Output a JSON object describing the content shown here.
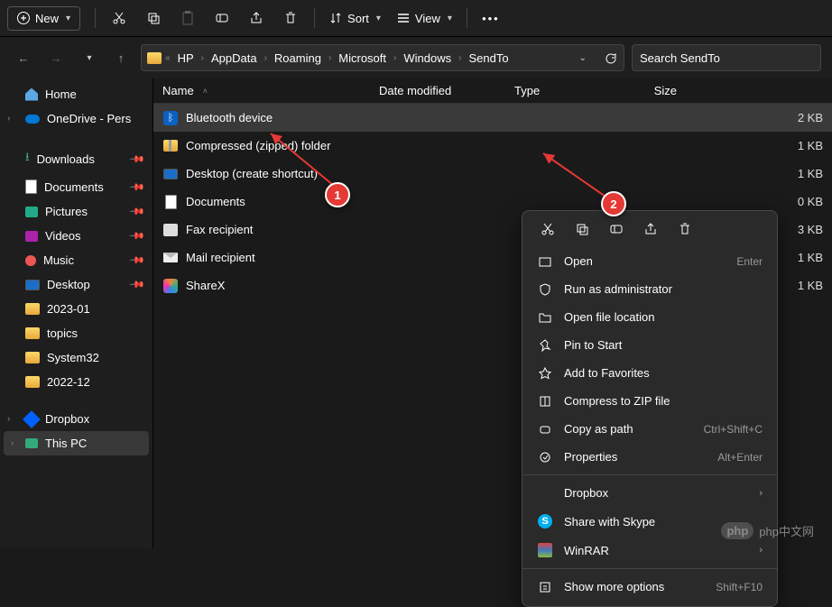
{
  "toolbar": {
    "new_label": "New",
    "sort_label": "Sort",
    "view_label": "View"
  },
  "breadcrumb": [
    "HP",
    "AppData",
    "Roaming",
    "Microsoft",
    "Windows",
    "SendTo"
  ],
  "search_placeholder": "Search SendTo",
  "columns": {
    "name": "Name",
    "date": "Date modified",
    "type": "Type",
    "size": "Size"
  },
  "sidebar": {
    "home": "Home",
    "onedrive": "OneDrive - Pers",
    "quick": [
      "Downloads",
      "Documents",
      "Pictures",
      "Videos",
      "Music",
      "Desktop",
      "2023-01",
      "topics",
      "System32",
      "2022-12"
    ],
    "bottom": [
      "Dropbox",
      "This PC"
    ]
  },
  "files": [
    {
      "name": "Bluetooth device",
      "size": "2 KB",
      "icon": "bluetooth"
    },
    {
      "name": "Compressed (zipped) folder",
      "size": "1 KB",
      "icon": "zip"
    },
    {
      "name": "Desktop (create shortcut)",
      "size": "1 KB",
      "icon": "monitor"
    },
    {
      "name": "Documents",
      "size": "0 KB",
      "icon": "doc"
    },
    {
      "name": "Fax recipient",
      "size": "3 KB",
      "icon": "fax"
    },
    {
      "name": "Mail recipient",
      "size": "1 KB",
      "icon": "mail"
    },
    {
      "name": "ShareX",
      "size": "1 KB",
      "icon": "sharex"
    }
  ],
  "ctx": {
    "open": "Open",
    "open_hint": "Enter",
    "runadmin": "Run as administrator",
    "openloc": "Open file location",
    "pin": "Pin to Start",
    "fav": "Add to Favorites",
    "zip": "Compress to ZIP file",
    "copypath": "Copy as path",
    "copypath_hint": "Ctrl+Shift+C",
    "props": "Properties",
    "props_hint": "Alt+Enter",
    "dropbox": "Dropbox",
    "skype": "Share with Skype",
    "winrar": "WinRAR",
    "more": "Show more options",
    "more_hint": "Shift+F10"
  },
  "callouts": {
    "c1": "1",
    "c2": "2"
  },
  "watermark": "php中文网"
}
